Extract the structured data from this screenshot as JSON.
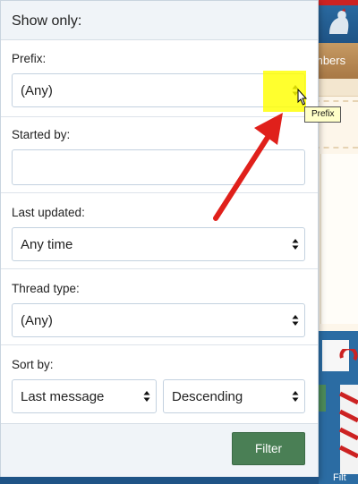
{
  "background": {
    "nav_members": "mbers",
    "filter_fragment": "Filt"
  },
  "menu": {
    "header": "Show only:",
    "prefix": {
      "label": "Prefix:",
      "value": "(Any)"
    },
    "started_by": {
      "label": "Started by:",
      "value": ""
    },
    "last_updated": {
      "label": "Last updated:",
      "value": "Any time"
    },
    "thread_type": {
      "label": "Thread type:",
      "value": "(Any)"
    },
    "sort_by": {
      "label": "Sort by:",
      "field": "Last message",
      "direction": "Descending"
    },
    "filter_button": "Filter"
  },
  "tooltip": {
    "text": "Prefix"
  },
  "colors": {
    "highlight": "#ffff00",
    "annotation_arrow": "#e0201b",
    "filter_button": "#4a7f55",
    "header_bg": "#f0f4f8"
  },
  "icons": [
    "select-arrows-icon",
    "mouse-cursor-icon",
    "annotation-arrow-icon",
    "site-logo-icon"
  ]
}
